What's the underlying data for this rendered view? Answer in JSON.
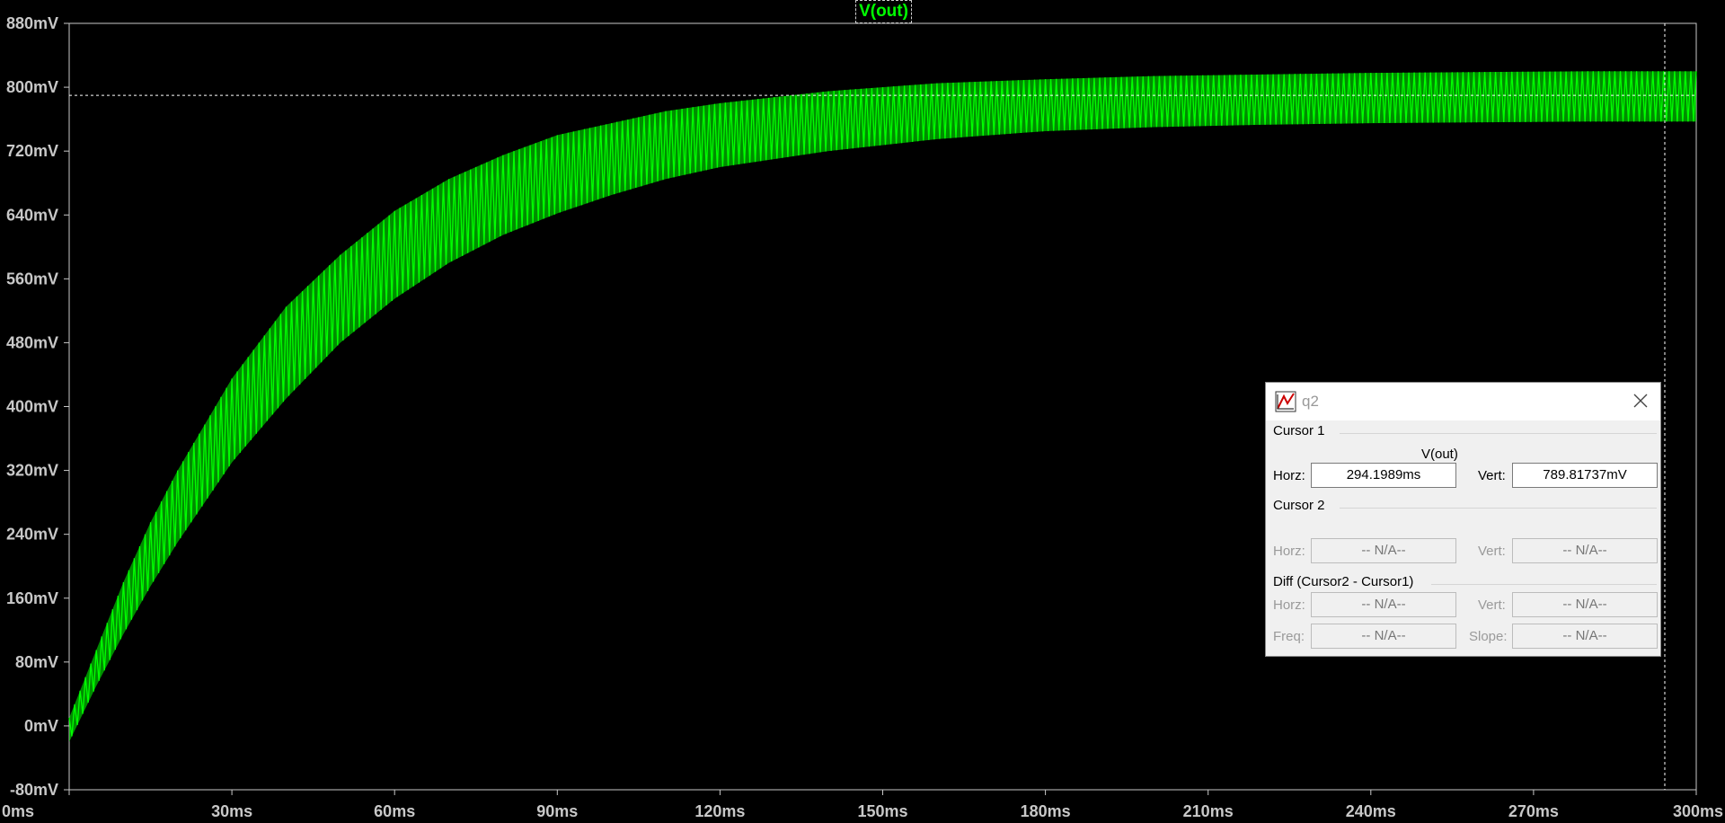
{
  "trace": {
    "label": "V(out)",
    "color": "#00ff00"
  },
  "chart_data": {
    "type": "line",
    "title": "",
    "xlabel": "",
    "ylabel": "",
    "xlim": [
      0,
      300
    ],
    "ylim": [
      -80,
      880
    ],
    "x_unit": "ms",
    "y_unit": "mV",
    "xticks": [
      "0ms",
      "30ms",
      "60ms",
      "90ms",
      "120ms",
      "150ms",
      "180ms",
      "210ms",
      "240ms",
      "270ms",
      "300ms"
    ],
    "yticks": [
      "880mV",
      "800mV",
      "720mV",
      "640mV",
      "560mV",
      "480mV",
      "400mV",
      "320mV",
      "240mV",
      "160mV",
      "80mV",
      "0mV",
      "-80mV"
    ],
    "grid": false,
    "series": [
      {
        "name": "V(out)",
        "x": [
          0,
          5,
          10,
          15,
          20,
          30,
          40,
          50,
          60,
          70,
          80,
          90,
          100,
          110,
          120,
          140,
          160,
          180,
          200,
          220,
          240,
          260,
          280,
          300
        ],
        "upper": [
          10,
          95,
          180,
          255,
          320,
          435,
          525,
          590,
          645,
          685,
          715,
          740,
          755,
          770,
          780,
          795,
          805,
          810,
          814,
          816,
          818,
          819,
          820,
          820
        ],
        "lower": [
          -20,
          50,
          115,
          175,
          230,
          330,
          410,
          480,
          535,
          580,
          615,
          642,
          665,
          685,
          700,
          720,
          735,
          745,
          750,
          753,
          755,
          756,
          757,
          757
        ]
      }
    ],
    "cursor": {
      "x": 294.1989,
      "y": 789.81737
    }
  },
  "cursor_dialog": {
    "title": "q2",
    "cursor1": {
      "group": "Cursor 1",
      "trace": "V(out)",
      "horz_label": "Horz:",
      "horz_value": "294.1989ms",
      "vert_label": "Vert:",
      "vert_value": "789.81737mV"
    },
    "cursor2": {
      "group": "Cursor 2",
      "horz_label": "Horz:",
      "horz_value": "-- N/A--",
      "vert_label": "Vert:",
      "vert_value": "-- N/A--"
    },
    "diff": {
      "group": "Diff (Cursor2 - Cursor1)",
      "horz_label": "Horz:",
      "horz_value": "-- N/A--",
      "vert_label": "Vert:",
      "vert_value": "-- N/A--",
      "freq_label": "Freq:",
      "freq_value": "-- N/A--",
      "slope_label": "Slope:",
      "slope_value": "-- N/A--"
    }
  }
}
